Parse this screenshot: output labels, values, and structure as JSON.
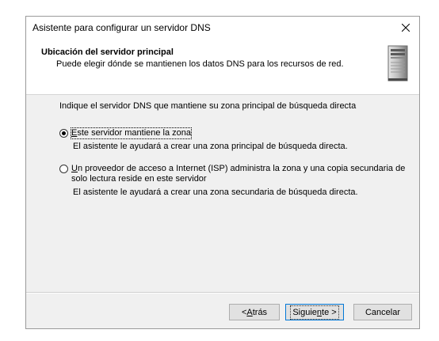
{
  "window": {
    "title": "Asistente para configurar un servidor DNS"
  },
  "header": {
    "title": "Ubicación del servidor principal",
    "subtitle": "Puede elegir dónde se mantienen los datos DNS para los recursos de red."
  },
  "body": {
    "prompt": "Indique el servidor DNS que mantiene su zona principal de búsqueda directa",
    "options": [
      {
        "mnemonic": "E",
        "label_rest": "ste servidor mantiene la zona",
        "description": "El asistente le ayudará a crear una zona principal de búsqueda directa.",
        "selected": true
      },
      {
        "mnemonic": "U",
        "label_rest": "n proveedor de acceso a Internet (ISP) administra la zona y una copia secundaria de",
        "label_line2": "solo lectura reside en este servidor",
        "description": "El asistente le ayudará a crear una zona secundaria de búsqueda directa.",
        "selected": false
      }
    ]
  },
  "buttons": {
    "back_prefix": "< ",
    "back_mnemonic": "A",
    "back_rest": "trás",
    "next_prefix": "Siguie",
    "next_mnemonic": "n",
    "next_rest": "te >",
    "cancel": "Cancelar"
  },
  "icons": {
    "close": "close-icon",
    "server": "server-icon"
  }
}
